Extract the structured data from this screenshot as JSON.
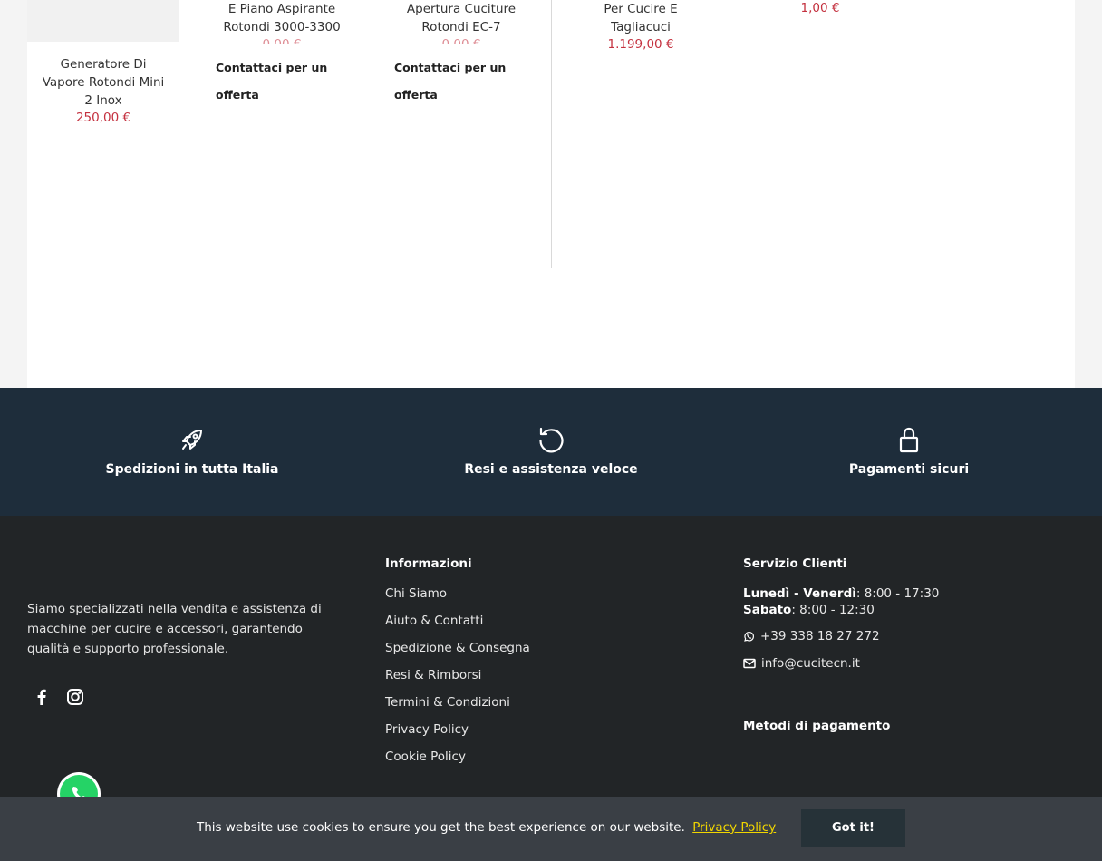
{
  "products": [
    {
      "title": "Generatore Di\nVapore Rotondi Mini\n2 Inox",
      "price": "250,00 €"
    },
    {
      "title": "E Piano Aspirante\nRotondi 3000-3300",
      "price": "0,00 €",
      "cta": "Contattaci per un\nofferta"
    },
    {
      "title": "Apertura Cuciture\nRotondi EC-7",
      "price": "0,00 €",
      "cta": "Contattaci per un\nofferta"
    },
    {
      "title": "Per Cucire E\nTagliacuci",
      "price": "1.199,00 €"
    },
    {
      "title": "",
      "price": "1,00 €"
    }
  ],
  "features": [
    {
      "icon": "rocket-icon",
      "label": "Spedizioni in tutta Italia"
    },
    {
      "icon": "refresh-icon",
      "label": "Resi e assistenza veloce"
    },
    {
      "icon": "lock-icon",
      "label": "Pagamenti sicuri"
    }
  ],
  "footer": {
    "about": "Siamo specializzati nella vendita e assistenza di macchine per cucire e accessori, garantendo qualità e supporto professionale.",
    "social": [
      "facebook-icon",
      "instagram-icon"
    ],
    "info_title": "Informazioni",
    "links": [
      "Chi Siamo",
      "Aiuto & Contatti",
      "Spedizione & Consegna",
      "Resi & Rimborsi",
      "Termini & Condizioni",
      "Privacy Policy",
      "Cookie Policy"
    ],
    "service_title": "Servizio Clienti",
    "hours": [
      {
        "day": "Lunedì - Venerdì",
        "time": ": 8:00 - 17:30"
      },
      {
        "day": "Sabato",
        "time": ": 8:00 - 12:30"
      }
    ],
    "phone": "+39 338 18 27 272",
    "email": "info@cucitecn.it",
    "payments_title": "Metodi di pagamento"
  },
  "cookie": {
    "message": "This website use cookies to ensure you get the best experience on our website.",
    "link": "Privacy Policy",
    "button": "Got it!"
  },
  "colors": {
    "price": "#c4313f",
    "feature_bg": "#1e2d3b",
    "footer_bg": "#222527",
    "cookie_bg": "#3a3f45",
    "cookie_link": "#f1d600",
    "whatsapp": "#25d366"
  }
}
